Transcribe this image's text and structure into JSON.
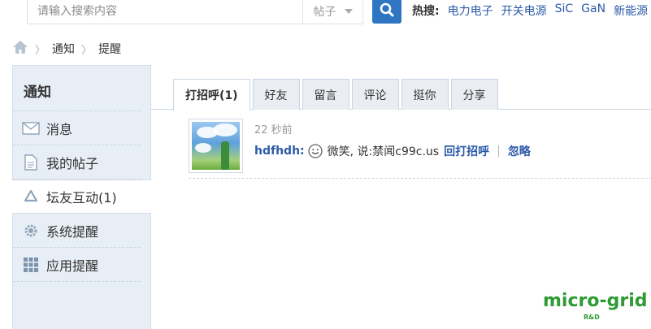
{
  "search": {
    "placeholder": "请输入搜索内容",
    "scope": "帖子",
    "hot_label": "热搜:",
    "hot_terms": [
      "电力电子",
      "开关电源",
      "SiC",
      "GaN",
      "新能源"
    ]
  },
  "breadcrumb": {
    "items": [
      "通知",
      "提醒"
    ]
  },
  "sidebar": {
    "title": "通知",
    "items": [
      {
        "label": "消息",
        "icon": "envelope-icon"
      },
      {
        "label": "我的帖子",
        "icon": "document-icon"
      },
      {
        "label": "坛友互动(1)",
        "icon": "recycle-icon",
        "active": true
      },
      {
        "label": "系统提醒",
        "icon": "gear-icon"
      },
      {
        "label": "应用提醒",
        "icon": "grid-icon"
      }
    ]
  },
  "tabs": [
    "打招呼(1)",
    "好友",
    "留言",
    "评论",
    "挺你",
    "分享"
  ],
  "notice": {
    "time": "22 秒前",
    "user": "hdfhdh:",
    "message": "微笑, 说:禁闻c99c.us",
    "reply_action": "回打招呼",
    "ignore_action": "忽略"
  },
  "watermark": {
    "text": "micro-grid",
    "sub": "R&D"
  },
  "colors": {
    "accent": "#2e76c1",
    "link": "#2b5aa8",
    "sidebar_bg": "#e7eef6",
    "watermark": "#2e9b33"
  }
}
